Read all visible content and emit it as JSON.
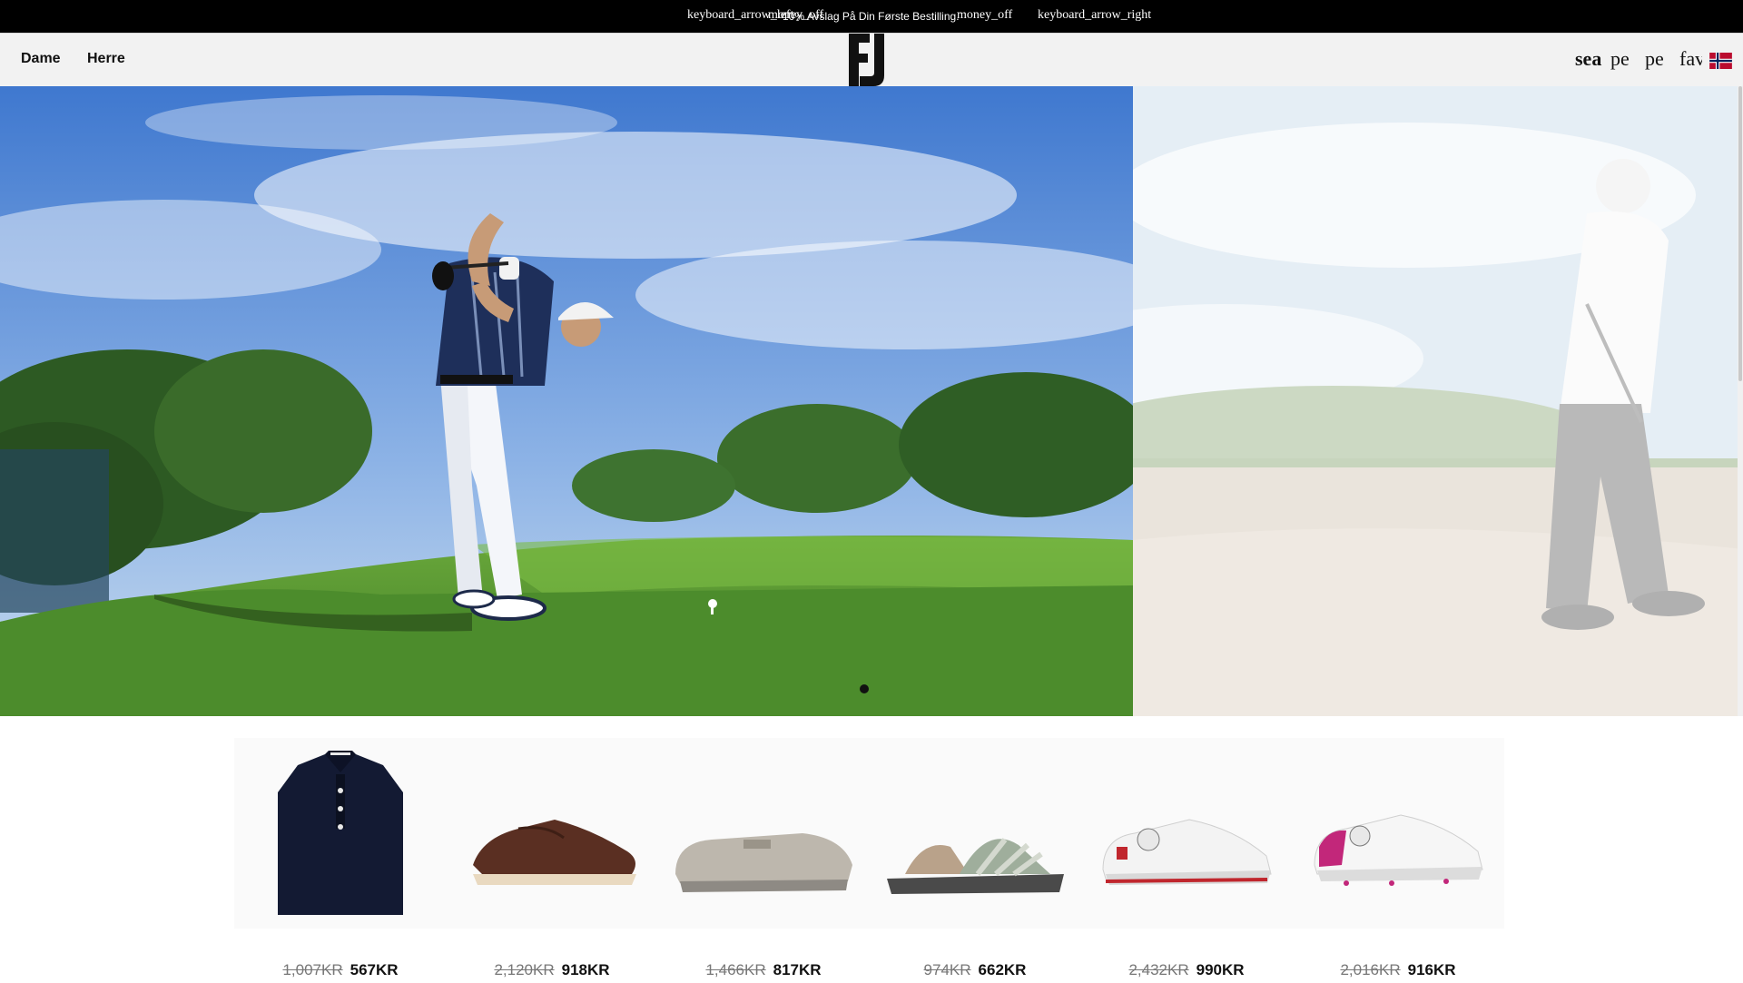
{
  "promo_bar": {
    "left_arrow_glyph": "keyboard_arrow_left",
    "money_icon_text_left": "money_off",
    "message": "10% Avslag På Din Første Bestilling.",
    "money_icon_text_right": "money_off",
    "right_arrow_glyph": "keyboard_arrow_right"
  },
  "header": {
    "nav": [
      "Dame",
      "Herre"
    ],
    "logo_text": "FJ",
    "utility": {
      "search_text": "sea",
      "person_text_1": "pe",
      "person_text_2": "pe",
      "favorites_text": "fav"
    },
    "flag_icon": "norway-flag-icon"
  },
  "hero": {
    "slides": [
      {
        "subject": "golfer-driver-swing"
      },
      {
        "subject": "golfer-bunker-shot"
      }
    ],
    "active_slide": 1
  },
  "products": [
    {
      "name": "navy-polo",
      "old_price": "1,007KR",
      "price": "567KR"
    },
    {
      "name": "brown-wingtip-shoe",
      "old_price": "2,120KR",
      "price": "918KR"
    },
    {
      "name": "grey-slip-on-shoe",
      "old_price": "1,466KR",
      "price": "817KR"
    },
    {
      "name": "sport-sandal",
      "old_price": "974KR",
      "price": "662KR"
    },
    {
      "name": "white-red-boa-shoe",
      "old_price": "2,432KR",
      "price": "990KR"
    },
    {
      "name": "white-pink-boa-shoe",
      "old_price": "2,016KR",
      "price": "916KR"
    }
  ],
  "colors": {
    "promo_bg": "#000000",
    "header_bg": "#f2f2f2",
    "sky": "#4f86d6",
    "grass": "#4e8f2e"
  }
}
